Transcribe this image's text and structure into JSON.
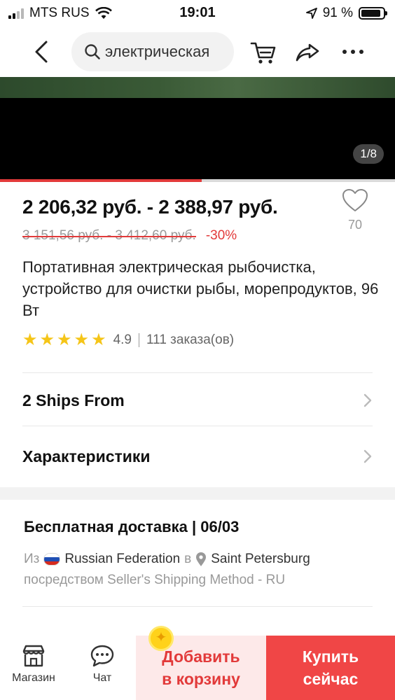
{
  "status_bar": {
    "carrier": "MTS RUS",
    "time": "19:01",
    "battery": "91 %",
    "battery_level": 0.91,
    "signal_bars": 2
  },
  "nav": {
    "search_text": "электрическая",
    "icons": [
      "back-icon",
      "search-icon",
      "cart-icon",
      "share-icon",
      "more-icon"
    ]
  },
  "media": {
    "counter": "1/8",
    "progress": 0.51
  },
  "product": {
    "price_range": "2 206,32 руб. - 2 388,97 руб.",
    "old_price": "3 151,56 руб. - 3 412,60 руб.",
    "discount": "-30%",
    "favorites": "70",
    "title": "Портативная электрическая рыбочистка, устройство для очистки рыбы, морепродуктов, 96 Вт",
    "rating": "4.9",
    "stars": 5,
    "orders": "111 заказа(ов)"
  },
  "rows": [
    {
      "label": "2 Ships From"
    },
    {
      "label": "Характеристики"
    }
  ],
  "shipping": {
    "title": "Бесплатная доставка | 06/03",
    "from_prefix": "Из",
    "from_country": "Russian Federation",
    "in_word": "в",
    "to_city": "Saint Petersburg",
    "method": "посредством Seller's Shipping Method - RU"
  },
  "bottom_bar": {
    "store_label": "Магазин",
    "chat_label": "Чат",
    "add_to_cart_line1": "Добавить",
    "add_to_cart_line2": "в корзину",
    "buy_now_line1": "Купить",
    "buy_now_line2": "сейчас"
  },
  "colors": {
    "accent": "#e23a3a",
    "buy_button": "#f04646",
    "cart_button_bg": "#fde9e9",
    "star": "#f5c518"
  }
}
